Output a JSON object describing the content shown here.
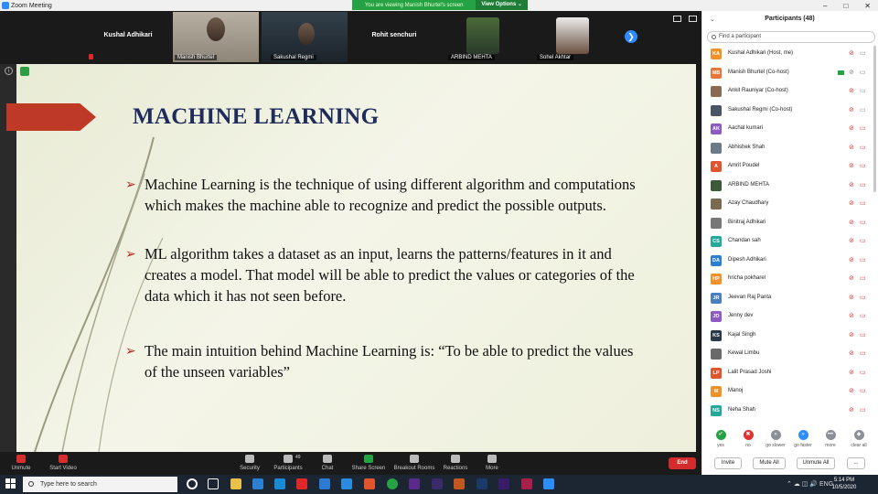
{
  "window": {
    "title": "Zoom Meeting"
  },
  "share_banner": {
    "message": "You are viewing Manish Bhurtel's screen",
    "view_options": "View Options ⌄"
  },
  "video_strip": {
    "tiles": [
      {
        "name": "Kushal Adhikari",
        "label": ""
      },
      {
        "name": "",
        "label": "Manish Bhurtel"
      },
      {
        "name": "",
        "label": "Sakushal Regmi"
      },
      {
        "name": "Rohit senchuri",
        "label": ""
      },
      {
        "name": "",
        "label": "ARBIND MEHTA"
      },
      {
        "name": "",
        "label": "Sohel Akhtar"
      }
    ],
    "next_arrow": "❯"
  },
  "slide": {
    "title": "MACHINE LEARNING",
    "bullets": [
      "Machine Learning is the technique of using different algorithm and computations which makes the machine able to recognize and predict the possible outputs.",
      "ML algorithm takes a dataset as an input, learns the patterns/features in it and creates a model. That model will be able to predict the values or categories of the data which it has not seen before.",
      "The main intuition behind Machine Learning is: “To be able to predict the values of the unseen variables”"
    ],
    "bullet_marker": "➢"
  },
  "toolbar": {
    "unmute": "Unmute",
    "start_video": "Start Video",
    "security": "Security",
    "participants": "Participants",
    "participants_count": "49",
    "chat": "Chat",
    "share_screen": "Share Screen",
    "breakout_rooms": "Breakout Rooms",
    "reactions": "Reactions",
    "more": "More",
    "end": "End"
  },
  "participants_panel": {
    "title": "Participants (48)",
    "collapse": "⌄",
    "search_placeholder": "Find a participant",
    "participants": [
      {
        "initials": "KA",
        "name": "Kushal Adhikari (Host, me)",
        "color": "#f0922c"
      },
      {
        "initials": "MB",
        "name": "Manish Bhurtel (Co-host)",
        "color": "#e8763a"
      },
      {
        "initials": "",
        "name": "Ankit Rauniyar (Co-host)",
        "color": "#8c6a52"
      },
      {
        "initials": "",
        "name": "Sakushal Regmi (Co-host)",
        "color": "#4a5566"
      },
      {
        "initials": "AK",
        "name": "Aachal kumari",
        "color": "#8e5bc4"
      },
      {
        "initials": "",
        "name": "Abhishek Shah",
        "color": "#6b7b8a"
      },
      {
        "initials": "A",
        "name": "Amrit Poudel",
        "color": "#e0552e"
      },
      {
        "initials": "",
        "name": "ARBIND MEHTA",
        "color": "#3c5a3a"
      },
      {
        "initials": "",
        "name": "Azay Chaudhary",
        "color": "#7a6a4e"
      },
      {
        "initials": "",
        "name": "Binitraj Adhikari",
        "color": "#777777"
      },
      {
        "initials": "CS",
        "name": "Chandan sah",
        "color": "#24a89a"
      },
      {
        "initials": "DA",
        "name": "Dipesh Adhikari",
        "color": "#2d7fd1"
      },
      {
        "initials": "HP",
        "name": "hricha pokharel",
        "color": "#f0922c"
      },
      {
        "initials": "JR",
        "name": "Jeevan Raj Panta",
        "color": "#4a7fc4"
      },
      {
        "initials": "JD",
        "name": "Jenny dev",
        "color": "#8e5bc4"
      },
      {
        "initials": "KS",
        "name": "Kajal Singh",
        "color": "#2a3a4a"
      },
      {
        "initials": "",
        "name": "Kewal Limbu",
        "color": "#6a6a6a"
      },
      {
        "initials": "LP",
        "name": "Lalit Prasad Joshi",
        "color": "#e0552e"
      },
      {
        "initials": "M",
        "name": "Manoj",
        "color": "#f0922c"
      },
      {
        "initials": "NS",
        "name": "Neha Shah",
        "color": "#24a89a"
      }
    ],
    "reactions": [
      {
        "label": "yes",
        "symbol": "✔",
        "color": "#25a244"
      },
      {
        "label": "no",
        "symbol": "✖",
        "color": "#e03030"
      },
      {
        "label": "go slower",
        "symbol": "«",
        "color": "#8a8f98"
      },
      {
        "label": "go faster",
        "symbol": "»",
        "color": "#2d8cff"
      },
      {
        "label": "more",
        "symbol": "•••",
        "color": "#8a8f98"
      },
      {
        "label": "clear all",
        "symbol": "◆",
        "color": "#8a8f98"
      }
    ],
    "buttons": {
      "invite": "Invite",
      "mute_all": "Mute All",
      "unmute_all": "Unmute All",
      "more": "..."
    }
  },
  "taskbar": {
    "search_placeholder": "Type here to search",
    "time": "5:14 PM",
    "date": "10/5/2020",
    "tray": "⌃ ☁ ◫ 🔊 ENG"
  }
}
